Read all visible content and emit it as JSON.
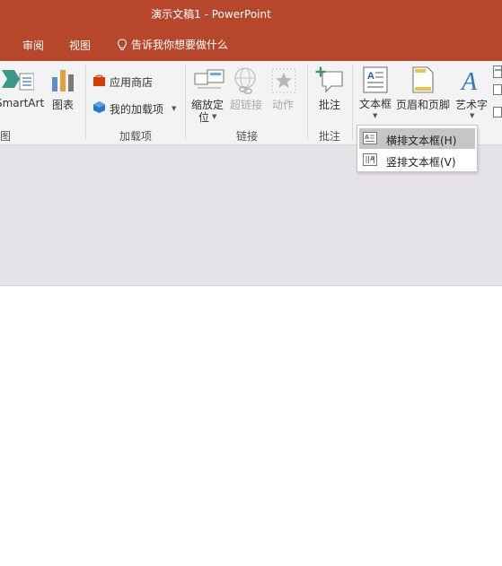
{
  "window": {
    "title": "演示文稿1  -  PowerPoint",
    "accent_color": "#b7472a"
  },
  "tabs": {
    "review": "审阅",
    "view": "视图",
    "tell_me": "告诉我你想要做什么"
  },
  "ribbon": {
    "groups": {
      "illustrations": {
        "label": "图",
        "smartart": "SmartArt",
        "chart": "图表"
      },
      "addins": {
        "label": "加载项",
        "store": "应用商店",
        "my_addins": "我的加载项"
      },
      "links": {
        "label": "链接",
        "zoom_line1": "缩放定",
        "zoom_line2": "位",
        "hyperlink": "超链接",
        "action": "动作"
      },
      "comments": {
        "label": "批注",
        "comment": "批注"
      },
      "text": {
        "textbox": "文本框",
        "header_footer": "页眉和页脚",
        "wordart": "艺术字"
      }
    }
  },
  "dropdown": {
    "items": [
      {
        "label": "横排文本框(H)",
        "icon": "horizontal-textbox-icon",
        "highlighted": true
      },
      {
        "label": "竖排文本框(V)",
        "icon": "vertical-textbox-icon",
        "highlighted": false
      }
    ]
  }
}
